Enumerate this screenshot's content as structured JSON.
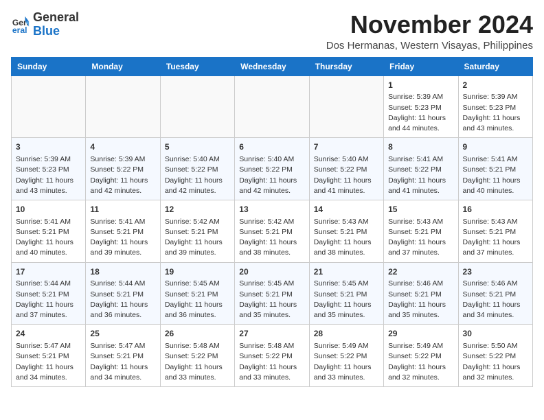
{
  "logo": {
    "line1": "General",
    "line2": "Blue"
  },
  "header": {
    "month_year": "November 2024",
    "location": "Dos Hermanas, Western Visayas, Philippines"
  },
  "weekdays": [
    "Sunday",
    "Monday",
    "Tuesday",
    "Wednesday",
    "Thursday",
    "Friday",
    "Saturday"
  ],
  "weeks": [
    [
      {
        "day": "",
        "detail": ""
      },
      {
        "day": "",
        "detail": ""
      },
      {
        "day": "",
        "detail": ""
      },
      {
        "day": "",
        "detail": ""
      },
      {
        "day": "",
        "detail": ""
      },
      {
        "day": "1",
        "detail": "Sunrise: 5:39 AM\nSunset: 5:23 PM\nDaylight: 11 hours and 44 minutes."
      },
      {
        "day": "2",
        "detail": "Sunrise: 5:39 AM\nSunset: 5:23 PM\nDaylight: 11 hours and 43 minutes."
      }
    ],
    [
      {
        "day": "3",
        "detail": "Sunrise: 5:39 AM\nSunset: 5:23 PM\nDaylight: 11 hours and 43 minutes."
      },
      {
        "day": "4",
        "detail": "Sunrise: 5:39 AM\nSunset: 5:22 PM\nDaylight: 11 hours and 42 minutes."
      },
      {
        "day": "5",
        "detail": "Sunrise: 5:40 AM\nSunset: 5:22 PM\nDaylight: 11 hours and 42 minutes."
      },
      {
        "day": "6",
        "detail": "Sunrise: 5:40 AM\nSunset: 5:22 PM\nDaylight: 11 hours and 42 minutes."
      },
      {
        "day": "7",
        "detail": "Sunrise: 5:40 AM\nSunset: 5:22 PM\nDaylight: 11 hours and 41 minutes."
      },
      {
        "day": "8",
        "detail": "Sunrise: 5:41 AM\nSunset: 5:22 PM\nDaylight: 11 hours and 41 minutes."
      },
      {
        "day": "9",
        "detail": "Sunrise: 5:41 AM\nSunset: 5:21 PM\nDaylight: 11 hours and 40 minutes."
      }
    ],
    [
      {
        "day": "10",
        "detail": "Sunrise: 5:41 AM\nSunset: 5:21 PM\nDaylight: 11 hours and 40 minutes."
      },
      {
        "day": "11",
        "detail": "Sunrise: 5:41 AM\nSunset: 5:21 PM\nDaylight: 11 hours and 39 minutes."
      },
      {
        "day": "12",
        "detail": "Sunrise: 5:42 AM\nSunset: 5:21 PM\nDaylight: 11 hours and 39 minutes."
      },
      {
        "day": "13",
        "detail": "Sunrise: 5:42 AM\nSunset: 5:21 PM\nDaylight: 11 hours and 38 minutes."
      },
      {
        "day": "14",
        "detail": "Sunrise: 5:43 AM\nSunset: 5:21 PM\nDaylight: 11 hours and 38 minutes."
      },
      {
        "day": "15",
        "detail": "Sunrise: 5:43 AM\nSunset: 5:21 PM\nDaylight: 11 hours and 37 minutes."
      },
      {
        "day": "16",
        "detail": "Sunrise: 5:43 AM\nSunset: 5:21 PM\nDaylight: 11 hours and 37 minutes."
      }
    ],
    [
      {
        "day": "17",
        "detail": "Sunrise: 5:44 AM\nSunset: 5:21 PM\nDaylight: 11 hours and 37 minutes."
      },
      {
        "day": "18",
        "detail": "Sunrise: 5:44 AM\nSunset: 5:21 PM\nDaylight: 11 hours and 36 minutes."
      },
      {
        "day": "19",
        "detail": "Sunrise: 5:45 AM\nSunset: 5:21 PM\nDaylight: 11 hours and 36 minutes."
      },
      {
        "day": "20",
        "detail": "Sunrise: 5:45 AM\nSunset: 5:21 PM\nDaylight: 11 hours and 35 minutes."
      },
      {
        "day": "21",
        "detail": "Sunrise: 5:45 AM\nSunset: 5:21 PM\nDaylight: 11 hours and 35 minutes."
      },
      {
        "day": "22",
        "detail": "Sunrise: 5:46 AM\nSunset: 5:21 PM\nDaylight: 11 hours and 35 minutes."
      },
      {
        "day": "23",
        "detail": "Sunrise: 5:46 AM\nSunset: 5:21 PM\nDaylight: 11 hours and 34 minutes."
      }
    ],
    [
      {
        "day": "24",
        "detail": "Sunrise: 5:47 AM\nSunset: 5:21 PM\nDaylight: 11 hours and 34 minutes."
      },
      {
        "day": "25",
        "detail": "Sunrise: 5:47 AM\nSunset: 5:21 PM\nDaylight: 11 hours and 34 minutes."
      },
      {
        "day": "26",
        "detail": "Sunrise: 5:48 AM\nSunset: 5:22 PM\nDaylight: 11 hours and 33 minutes."
      },
      {
        "day": "27",
        "detail": "Sunrise: 5:48 AM\nSunset: 5:22 PM\nDaylight: 11 hours and 33 minutes."
      },
      {
        "day": "28",
        "detail": "Sunrise: 5:49 AM\nSunset: 5:22 PM\nDaylight: 11 hours and 33 minutes."
      },
      {
        "day": "29",
        "detail": "Sunrise: 5:49 AM\nSunset: 5:22 PM\nDaylight: 11 hours and 32 minutes."
      },
      {
        "day": "30",
        "detail": "Sunrise: 5:50 AM\nSunset: 5:22 PM\nDaylight: 11 hours and 32 minutes."
      }
    ]
  ]
}
